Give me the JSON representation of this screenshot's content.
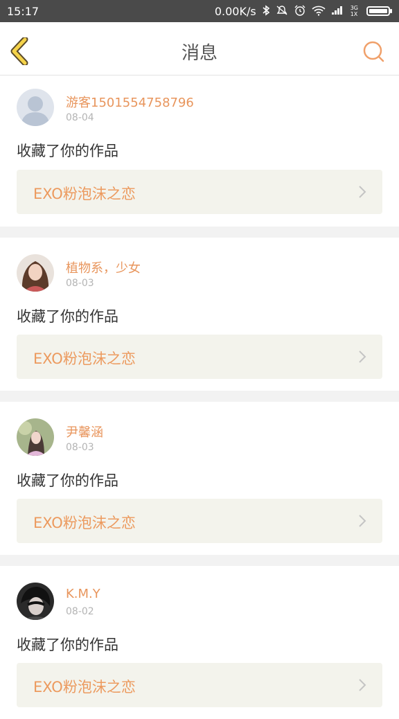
{
  "status_bar": {
    "time": "15:17",
    "network_speed": "0.00K/s",
    "signal_small_top": "3G",
    "signal_small_bottom": "1X",
    "icons": [
      "bluetooth-icon",
      "mute-icon",
      "alarm-icon",
      "wifi-icon",
      "signal-icon",
      "battery-icon"
    ]
  },
  "header": {
    "title": "消息",
    "back_icon": "chevron-left-icon",
    "search_icon": "search-icon"
  },
  "colors": {
    "accent": "#e8955c",
    "back_arrow_fill": "#f5d34a",
    "back_arrow_stroke": "#5a4a2a"
  },
  "messages": [
    {
      "user": "游客1501554758796",
      "date": "08-04",
      "action": "收藏了你的作品",
      "work_title": "EXO粉泡沫之恋",
      "avatar": "default-avatar"
    },
    {
      "user": "植物系，少女",
      "date": "08-03",
      "action": "收藏了你的作品",
      "work_title": "EXO粉泡沫之恋",
      "avatar": "photo-avatar"
    },
    {
      "user": "尹馨涵",
      "date": "08-03",
      "action": "收藏了你的作品",
      "work_title": "EXO粉泡沫之恋",
      "avatar": "photo-avatar"
    },
    {
      "user": "K.M.Y",
      "date": "08-02",
      "action": "收藏了你的作品",
      "work_title": "EXO粉泡沫之恋",
      "avatar": "photo-avatar"
    }
  ]
}
